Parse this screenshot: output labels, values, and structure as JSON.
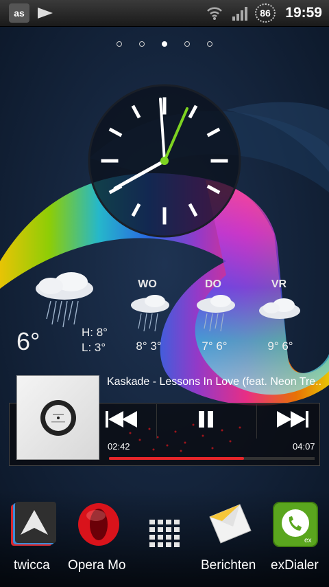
{
  "status_bar": {
    "time": "19:59",
    "battery_level": "86",
    "notification_icons": [
      "lastfm-icon",
      "play-icon"
    ],
    "system_icons": [
      "wifi-icon",
      "signal-icon",
      "battery-icon"
    ]
  },
  "home_pages": {
    "count": 5,
    "active_index": 2
  },
  "weather": {
    "current_temp": "6°",
    "high": "H: 8°",
    "low": "L: 3°",
    "forecast": [
      {
        "day": "WO",
        "temps": "8° 3°"
      },
      {
        "day": "DO",
        "temps": "7° 6°"
      },
      {
        "day": "VR",
        "temps": "9° 6°"
      }
    ]
  },
  "music": {
    "track": "Kaskade - Lessons In Love (feat. Neon Tre...",
    "elapsed": "02:42",
    "total": "04:07",
    "progress": 0.656
  },
  "dock": {
    "apps": [
      {
        "label": "twicca",
        "icon": "twicca-icon"
      },
      {
        "label": "Opera Mo",
        "icon": "opera-icon"
      },
      {
        "label": "",
        "icon": "app-drawer-icon"
      },
      {
        "label": "Berichten",
        "icon": "messages-icon"
      },
      {
        "label": "exDialer",
        "icon": "exdialer-icon"
      }
    ]
  },
  "colors": {
    "accent": "#e8262a",
    "clock_hand": "#7ed321"
  }
}
